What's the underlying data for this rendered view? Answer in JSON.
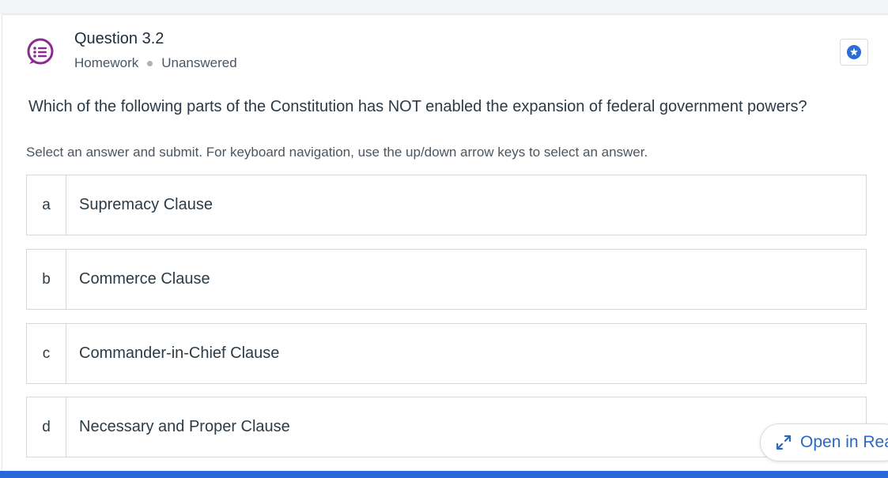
{
  "question": {
    "title": "Question 3.2",
    "type": "Homework",
    "status": "Unanswered",
    "prompt": "Which of the following parts of the Constitution has NOT enabled the expansion of federal government powers?",
    "instructions": "Select an answer and submit. For keyboard navigation, use the up/down arrow keys to select an answer."
  },
  "options": [
    {
      "letter": "a",
      "text": "Supremacy Clause"
    },
    {
      "letter": "b",
      "text": "Commerce Clause"
    },
    {
      "letter": "c",
      "text": "Commander-in-Chief Clause"
    },
    {
      "letter": "d",
      "text": "Necessary and Proper Clause"
    }
  ],
  "reader_button": {
    "label": "Open in Reader"
  },
  "icons": {
    "question": "question-list-icon",
    "star": "star-icon",
    "expand": "expand-arrows-icon"
  },
  "colors": {
    "accent": "#2868d8",
    "icon_purple": "#8a2b8f",
    "star_blue": "#2a6fd6"
  }
}
